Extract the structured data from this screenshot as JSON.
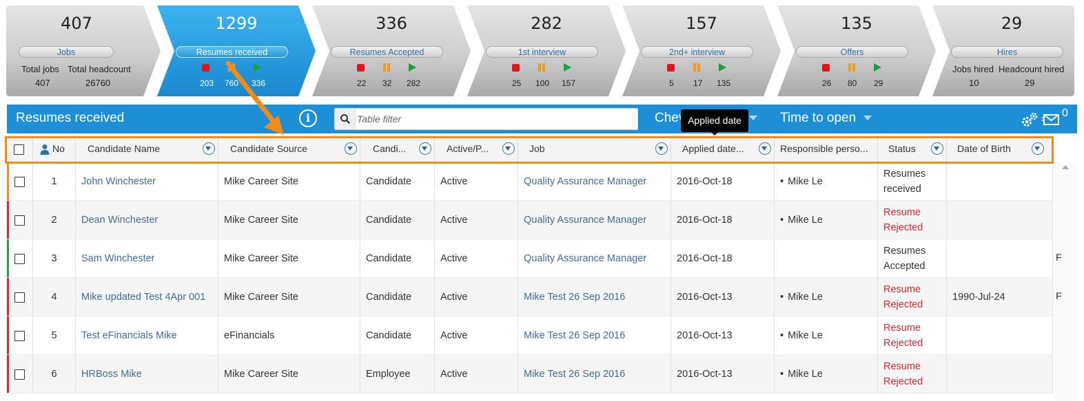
{
  "pipeline": {
    "stages": [
      {
        "count": "407",
        "label": "Jobs",
        "sub": {
          "l1": "Total jobs",
          "v1": "407",
          "l2": "Total headcount",
          "v2": "26760"
        }
      },
      {
        "count": "1299",
        "label": "Resumes received",
        "nums": [
          "203",
          "760",
          "336"
        ]
      },
      {
        "count": "336",
        "label": "Resumes Accepted",
        "nums": [
          "22",
          "32",
          "282"
        ]
      },
      {
        "count": "282",
        "label": "1st interview",
        "nums": [
          "25",
          "100",
          "157"
        ]
      },
      {
        "count": "157",
        "label": "2nd+ interview",
        "nums": [
          "5",
          "17",
          "135"
        ]
      },
      {
        "count": "135",
        "label": "Offers",
        "nums": [
          "26",
          "80",
          "29"
        ]
      },
      {
        "count": "29",
        "label": "Hires",
        "sub": {
          "l1": "Jobs hired",
          "v1": "10",
          "l2": "Headcount hired",
          "v2": "29"
        }
      }
    ]
  },
  "header": {
    "title": "Resumes received",
    "filter_placeholder": "Table filter",
    "link1": "Chev",
    "link2": "Time to open",
    "tooltip": "Applied date",
    "mail_count": "0"
  },
  "columns": [
    "No",
    "Candidate Name",
    "Candidate Source",
    "Candi...",
    "Active/P...",
    "Job",
    "Applied date...",
    "Responsible perso...",
    "Status",
    "Date of Birth"
  ],
  "rows": [
    {
      "no": "1",
      "name": "John Winchester",
      "source": "Mike Career Site",
      "type": "Candidate",
      "active": "Active",
      "job": "Quality Assurance Manager",
      "applied": "2016-Oct-18",
      "resp": "Mike Le",
      "status": "Resumes received",
      "status_kind": "normal",
      "dob": "",
      "trunc": ""
    },
    {
      "no": "2",
      "name": "Dean Winchester",
      "source": "Mike Career Site",
      "type": "Candidate",
      "active": "Active",
      "job": "Quality Assurance Manager",
      "applied": "2016-Oct-18",
      "resp": "Mike Le",
      "status": "Resume Rejected",
      "status_kind": "rejected",
      "dob": "",
      "trunc": ""
    },
    {
      "no": "3",
      "name": "Sam Winchester",
      "source": "Mike Career Site",
      "type": "Candidate",
      "active": "Active",
      "job": "Quality Assurance Manager",
      "applied": "2016-Oct-18",
      "resp": "",
      "status": "Resumes Accepted",
      "status_kind": "normal",
      "dob": "",
      "trunc": "F"
    },
    {
      "no": "4",
      "name": "Mike updated Test 4Apr 001",
      "source": "Mike Career Site",
      "type": "Candidate",
      "active": "Active",
      "job": "Mike Test 26 Sep 2016",
      "applied": "2016-Oct-13",
      "resp": "Mike Le",
      "status": "Resume Rejected",
      "status_kind": "rejected",
      "dob": "1990-Jul-24",
      "trunc": "F"
    },
    {
      "no": "5",
      "name": "Test eFinancials Mike",
      "source": "eFinancials",
      "type": "Candidate",
      "active": "Active",
      "job": "Mike Test 26 Sep 2016",
      "applied": "2016-Oct-13",
      "resp": "Mike Le",
      "status": "Resume Rejected",
      "status_kind": "rejected",
      "dob": "",
      "trunc": ""
    },
    {
      "no": "6",
      "name": "HRBoss Mike",
      "source": "Mike Career Site",
      "type": "Employee",
      "active": "Active",
      "job": "Mike Test 26 Sep 2016",
      "applied": "2016-Oct-13",
      "resp": "Mike Le",
      "status": "Resume Rejected",
      "status_kind": "rejected",
      "dob": "",
      "trunc": ""
    }
  ],
  "colors": {
    "accent": "#1d8fd6",
    "highlight": "#f38b1b",
    "rejected": "#d7282f",
    "link": "#3f6d96"
  }
}
